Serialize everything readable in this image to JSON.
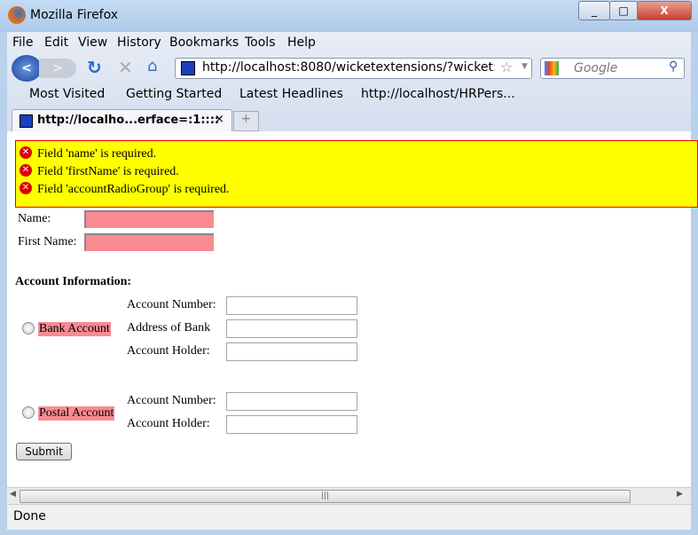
{
  "window": {
    "title": "Mozilla Firefox",
    "min": "_",
    "max": "□",
    "close": "X"
  },
  "menu": [
    "File",
    "Edit",
    "View",
    "History",
    "Bookmarks",
    "Tools",
    "Help"
  ],
  "nav": {
    "url": "http://localhost:8080/wicketextensions/?wicket:int",
    "search_placeholder": "Google"
  },
  "bookmarks": [
    "Most Visited",
    "Getting Started",
    "Latest Headlines",
    "http://localhost/HRPers..."
  ],
  "tab": {
    "title": "http://localho...erface=:1::::",
    "close": "×",
    "new": "+"
  },
  "page": {
    "errors": [
      "Field 'name' is required.",
      "Field 'firstName' is required.",
      "Field 'accountRadioGroup' is required."
    ],
    "name_label": "Name:",
    "first_name_label": "First Name:",
    "account_heading": "Account Information:",
    "bank": {
      "label": "Bank Account",
      "fields": [
        "Account Number:",
        "Address of Bank",
        "Account Holder:"
      ]
    },
    "postal": {
      "label": "Postal Account",
      "fields": [
        "Account Number:",
        "Account Holder:"
      ]
    },
    "submit": "Submit",
    "error_bg": "#ffff00",
    "invalid_bg": "#f98a93"
  },
  "status": "Done"
}
